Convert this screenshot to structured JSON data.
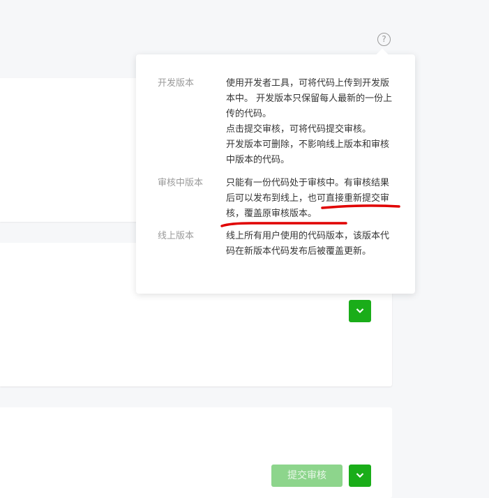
{
  "help_icon": "question-circle-icon",
  "popover": {
    "rows": [
      {
        "label": "开发版本",
        "lines": [
          "使用开发者工具，可将代码上传到开发版本中。 开发版本只保留每人最新的一份上传的代码。",
          "点击提交审核，可将代码提交审核。",
          "开发版本可删除，不影响线上版本和审核中版本的代码。"
        ]
      },
      {
        "label": "审核中版本",
        "lines": [
          "只能有一份代码处于审核中。有审核结果后可以发布到线上，也可直接重新提交审核，覆盖原审核版本。"
        ]
      },
      {
        "label": "线上版本",
        "lines": [
          "线上所有用户使用的代码版本，该版本代码在新版本代码发布后被覆盖更新。"
        ]
      }
    ]
  },
  "buttons": {
    "submit_review": "提交审核",
    "dropdown_icon": "chevron-down-icon"
  },
  "colors": {
    "primary": "#1aad19",
    "primary_disabled": "#8dd58c",
    "annotation": "#e00000"
  }
}
